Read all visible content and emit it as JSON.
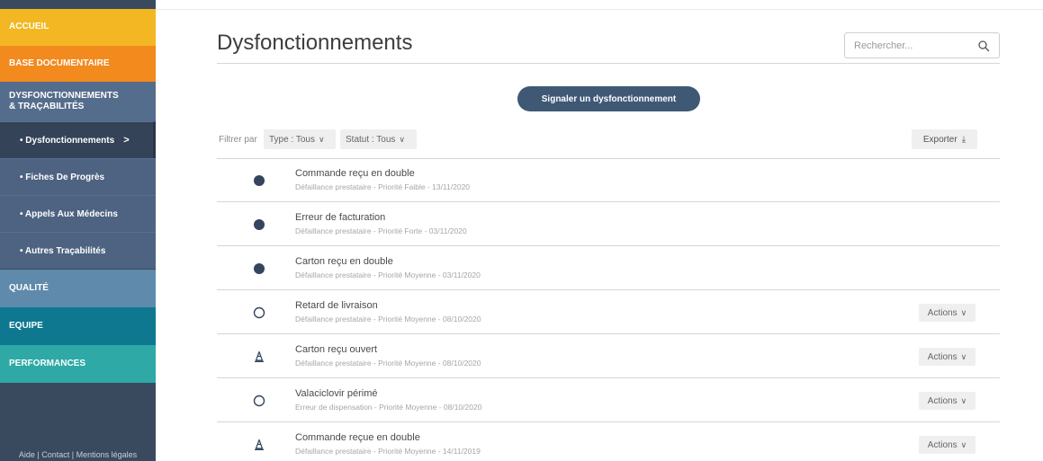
{
  "sidebar": {
    "accueil": "ACCUEIL",
    "base_documentaire": "BASE DOCUMENTAIRE",
    "dysfonctionnements_line1": "DYSFONCTIONNEMENTS",
    "dysfonctionnements_line2": "& TRAÇABILITÉS",
    "sub_items": [
      {
        "label": "• Dysfonctionnements",
        "chevron": ">"
      },
      {
        "label": "• Fiches De Progrès"
      },
      {
        "label": "• Appels Aux Médecins"
      },
      {
        "label": "• Autres Traçabilités"
      }
    ],
    "qualite": "QUALITÉ",
    "equipe": "EQUIPE",
    "performances": "PERFORMANCES",
    "footer": {
      "aide": "Aide",
      "contact": "Contact",
      "mentions": "Mentions légales",
      "sep": " | "
    }
  },
  "main": {
    "title": "Dysfonctionnements",
    "search_placeholder": "Rechercher...",
    "report_button": "Signaler un dysfonctionnement",
    "filter_label": "Filtrer par",
    "filter_type": "Type : Tous",
    "filter_statut": "Statut : Tous",
    "export": "Exporter"
  },
  "items": [
    {
      "title": "Commande reçu en double",
      "subtitle": "Défaillance prestataire - Priorité Faible - 13/11/2020",
      "status_icon": "filled-circle",
      "actions": ""
    },
    {
      "title": "Erreur de facturation",
      "subtitle": "Défaillance prestataire - Priorité Forte - 03/11/2020",
      "status_icon": "filled-circle",
      "actions": ""
    },
    {
      "title": "Carton reçu en double",
      "subtitle": "Défaillance prestataire - Priorité Moyenne - 03/11/2020",
      "status_icon": "filled-circle",
      "actions": ""
    },
    {
      "title": "Retard de livraison",
      "subtitle": "Défaillance prestataire - Priorité Moyenne - 08/10/2020",
      "status_icon": "empty-circle",
      "actions": "Actions"
    },
    {
      "title": "Carton reçu ouvert",
      "subtitle": "Défaillance prestataire - Priorité Moyenne - 08/10/2020",
      "status_icon": "traffic-cone",
      "actions": "Actions"
    },
    {
      "title": "Valaciclovir périmé",
      "subtitle": "Erreur de dispensation - Priorité Moyenne - 08/10/2020",
      "status_icon": "empty-circle",
      "actions": "Actions"
    },
    {
      "title": "Commande reçue en double",
      "subtitle": "Défaillance prestataire - Priorité Moyenne - 14/11/2019",
      "status_icon": "traffic-cone",
      "actions": "Actions"
    }
  ],
  "colors": {
    "accueil": "#f2b722",
    "base_documentaire": "#f28a1e",
    "dysfonctionnements": "#556d8c",
    "qualite": "#5f8aab",
    "equipe": "#0e7891",
    "performances": "#2ea9a6",
    "primary_button": "#3f5874",
    "status_filled": "#34455d"
  }
}
